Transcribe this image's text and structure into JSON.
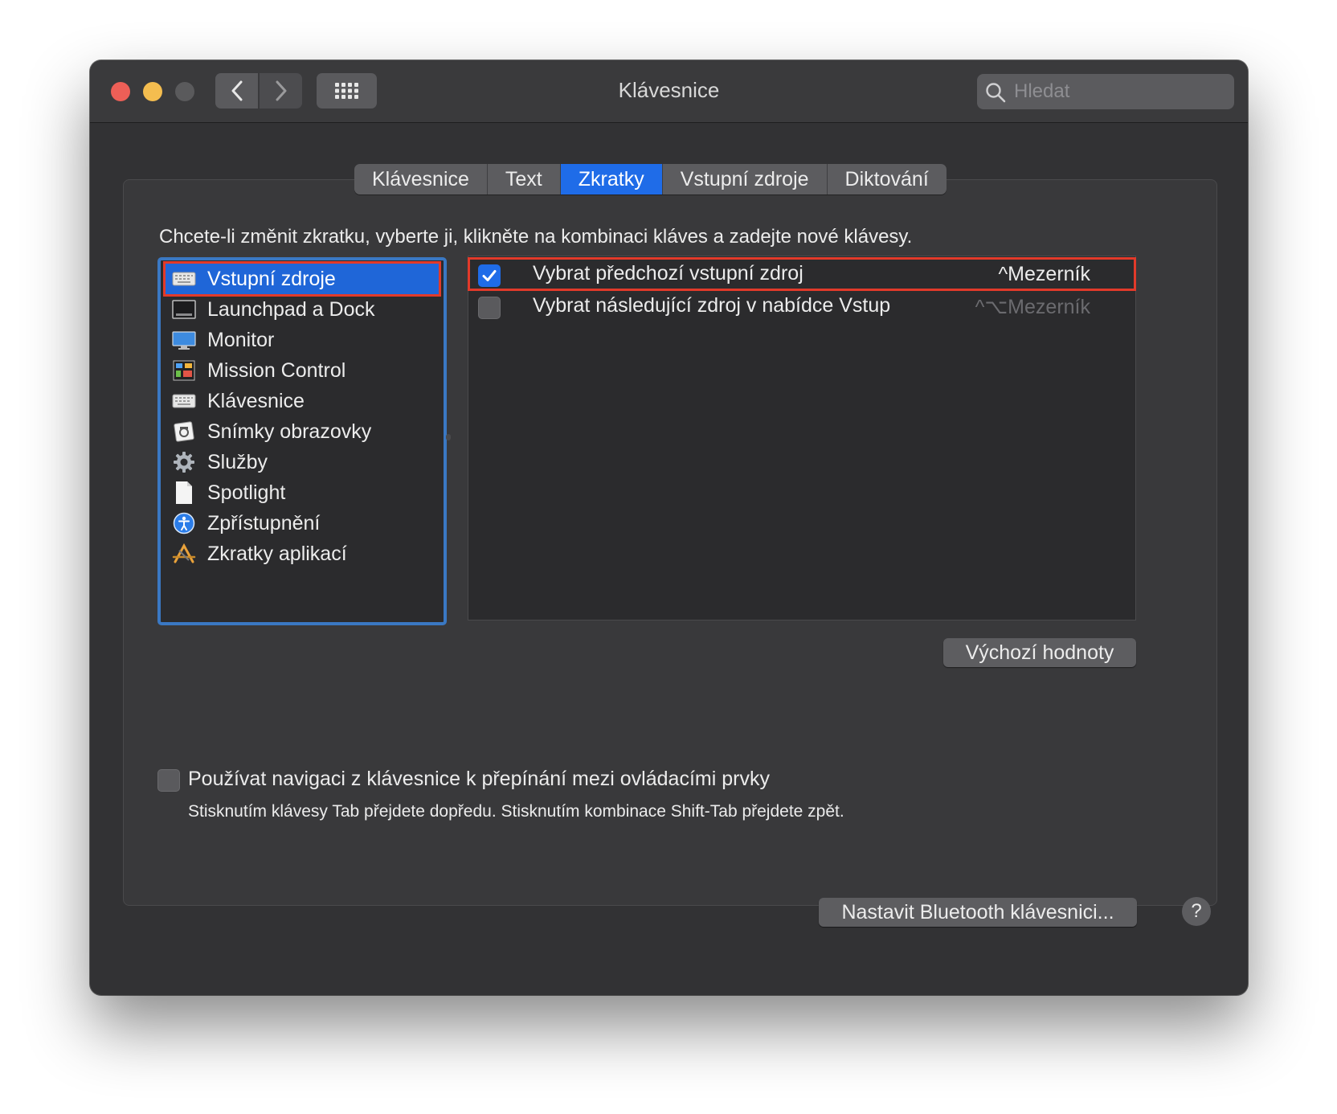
{
  "window": {
    "title": "Klávesnice"
  },
  "toolbar": {
    "back_icon": "chevron-left-icon",
    "forward_icon": "chevron-right-icon",
    "grid_icon": "grid-icon"
  },
  "search": {
    "placeholder": "Hledat"
  },
  "tabs": [
    {
      "label": "Klávesnice",
      "active": false
    },
    {
      "label": "Text",
      "active": false
    },
    {
      "label": "Zkratky",
      "active": true
    },
    {
      "label": "Vstupní zdroje",
      "active": false
    },
    {
      "label": "Diktování",
      "active": false
    }
  ],
  "instructions": "Chcete-li změnit zkratku, vyberte ji, klikněte na kombinaci kláves a zadejte nové klávesy.",
  "categories": [
    {
      "label": "Vstupní zdroje",
      "icon": "keyboard-icon",
      "selected": true
    },
    {
      "label": "Launchpad a Dock",
      "icon": "launchpad-icon",
      "selected": false
    },
    {
      "label": "Monitor",
      "icon": "monitor-icon",
      "selected": false
    },
    {
      "label": "Mission Control",
      "icon": "mission-control-icon",
      "selected": false
    },
    {
      "label": "Klávesnice",
      "icon": "keyboard-icon",
      "selected": false
    },
    {
      "label": "Snímky obrazovky",
      "icon": "screenshot-icon",
      "selected": false
    },
    {
      "label": "Služby",
      "icon": "gear-icon",
      "selected": false
    },
    {
      "label": "Spotlight",
      "icon": "document-icon",
      "selected": false
    },
    {
      "label": "Zpřístupnění",
      "icon": "accessibility-icon",
      "selected": false
    },
    {
      "label": "Zkratky aplikací",
      "icon": "app-store-icon",
      "selected": false
    }
  ],
  "shortcuts": [
    {
      "label": "Vybrat předchozí vstupní zdroj",
      "key": "^Mezerník",
      "checked": true
    },
    {
      "label": "Vybrat následující zdroj v nabídce Vstup",
      "key": "^⌥Mezerník",
      "checked": false
    }
  ],
  "buttons": {
    "defaults": "Výchozí hodnoty",
    "bluetooth": "Nastavit Bluetooth klávesnici...",
    "help": "?"
  },
  "keyboard_nav": {
    "label": "Používat navigaci z klávesnice k přepínání mezi ovládacími prvky",
    "hint": "Stisknutím klávesy Tab přejdete dopředu. Stisknutím kombinace Shift-Tab přejdete zpět.",
    "checked": false
  },
  "colors": {
    "accent": "#1f6ce8",
    "highlight_outline": "#e23a2a",
    "list_focus": "#3a78c3"
  }
}
